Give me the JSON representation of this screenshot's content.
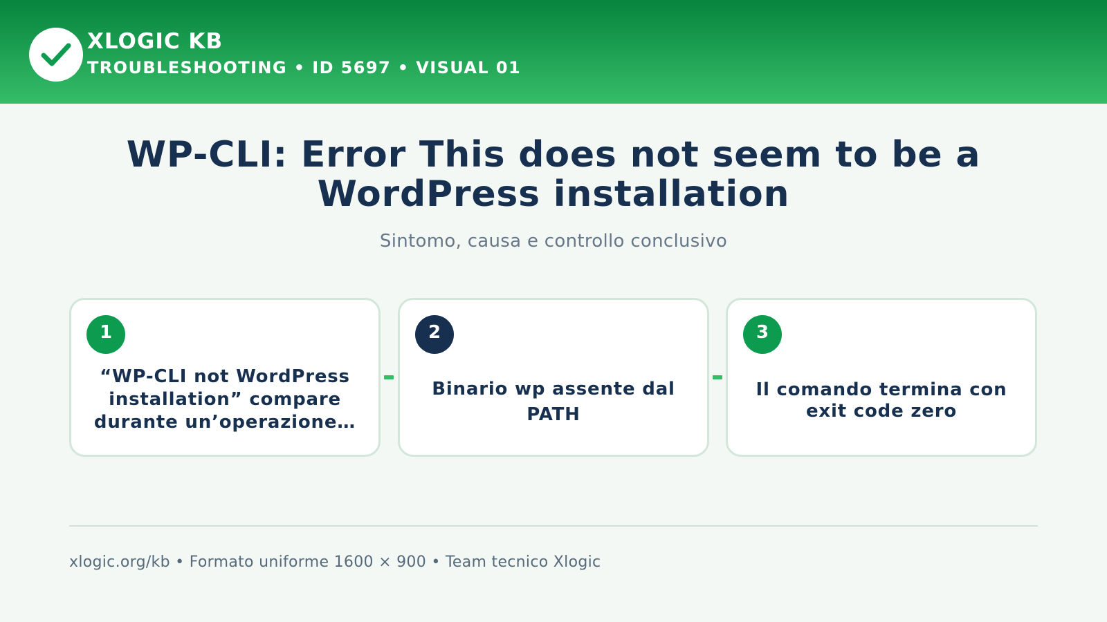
{
  "header": {
    "brand": "XLOGIC KB",
    "subtitle": "TROUBLESHOOTING • ID 5697 • VISUAL 01",
    "logo_icon": "check-icon"
  },
  "main": {
    "title": "WP-CLI: Error This does not seem to be a WordPress installation",
    "subtitle": "Sintomo, causa e controllo conclusivo"
  },
  "steps": [
    {
      "number": "1",
      "text": "“WP-CLI not WordPress installation” compare durante un’operazione…",
      "badge_color": "#0d9b4f"
    },
    {
      "number": "2",
      "text": "Binario wp assente dal PATH",
      "badge_color": "#17304f"
    },
    {
      "number": "3",
      "text": "Il comando termina con exit code zero",
      "badge_color": "#0d9b4f"
    }
  ],
  "footer": {
    "text": "xlogic.org/kb • Formato uniforme 1600 × 900 • Team tecnico Xlogic"
  },
  "colors": {
    "accent_green": "#0d9b4f",
    "header_top": "#07843e",
    "header_bottom": "#35bd68",
    "navy": "#17304f",
    "background": "#f4f8f5"
  }
}
